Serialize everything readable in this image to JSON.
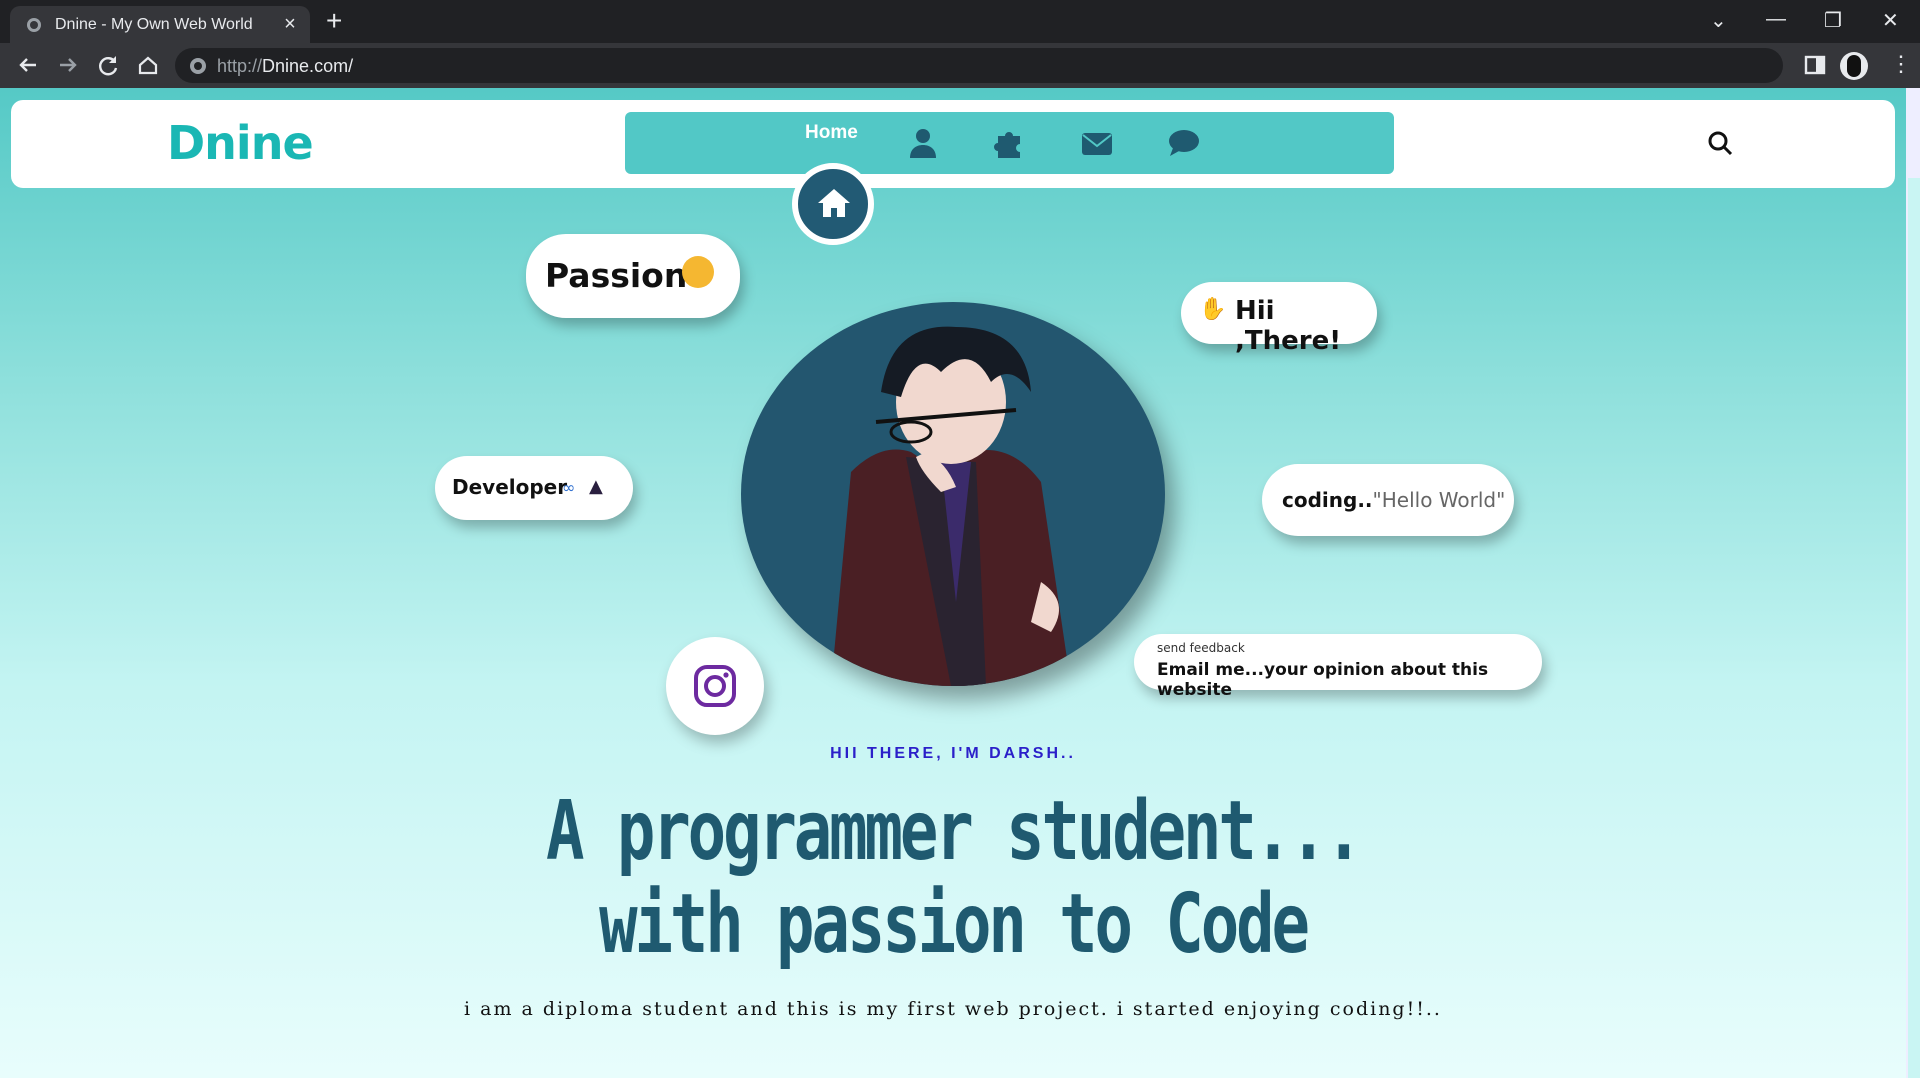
{
  "browser": {
    "tab_title": "Dnine - My Own Web World",
    "url_prefix": "http://",
    "url_host": "Dnine.com/"
  },
  "header": {
    "logo_text": "Dnine",
    "nav": {
      "home_label": "Home",
      "icons": [
        "user-icon",
        "puzzle-icon",
        "envelope-icon",
        "comment-icon"
      ]
    }
  },
  "hero": {
    "bubbles": {
      "passion": "Passion",
      "hii_there": "Hii ,There!",
      "developer": "Developer",
      "coding_prefix": "coding..",
      "coding_quote": "\"Hello World\"",
      "feedback_small": "send feedback",
      "feedback_main": "Email me...your opinion about this website"
    },
    "greeting": "HII THERE, I'M DARSH..",
    "headline_line1": "A programmer student...",
    "headline_line2": "with passion to Code",
    "subtext": "i am a diploma student and this is my first web project. i started enjoying coding!!.."
  },
  "colors": {
    "accent": "#52c8c6",
    "dark": "#23566f",
    "greeting": "#2b1fc9"
  }
}
